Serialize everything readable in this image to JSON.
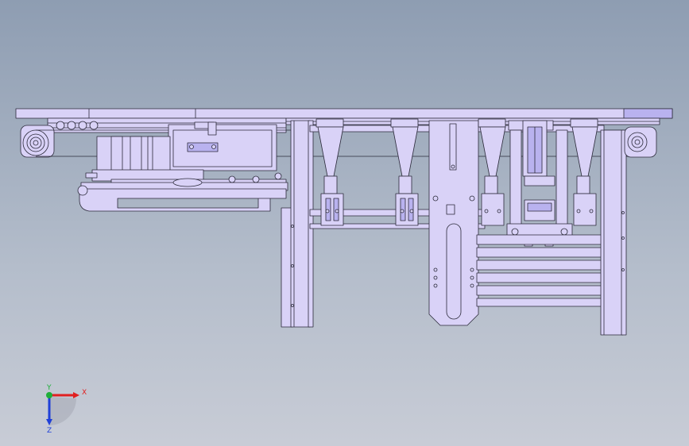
{
  "view": {
    "background_top": "#8e9db2",
    "background_bottom": "#c8ccd6",
    "part_fill": "#d9d2f7",
    "part_stroke": "#2b2a3a",
    "accent_fill": "#b9b2ef"
  },
  "triad": {
    "x_label": "X",
    "y_label": "Y",
    "z_label": "Z",
    "x_color": "#e02020",
    "y_color": "#1fae3a",
    "z_color": "#2040d8"
  }
}
